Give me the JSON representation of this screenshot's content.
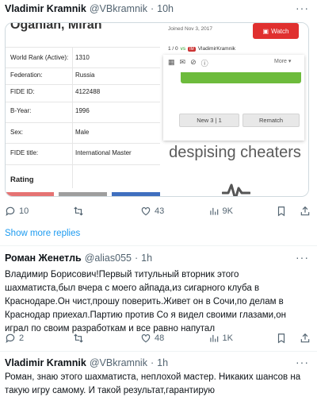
{
  "tweet1": {
    "name": "Vladimir Kramnik",
    "handle": "@VBkramnik",
    "dot": "·",
    "time": "10h",
    "media": {
      "player_name": "Oganian, Miran",
      "rows": [
        {
          "label": "World Rank (Active):",
          "value": "1310"
        },
        {
          "label": "Federation:",
          "value": "Russia"
        },
        {
          "label": "FIDE ID:",
          "value": "4122488"
        },
        {
          "label": "B-Year:",
          "value": "1996"
        },
        {
          "label": "Sex:",
          "value": "Male"
        },
        {
          "label": "FIDE title:",
          "value": "International Master"
        }
      ],
      "rating_label": "Rating",
      "joined": "Joined Nov 3, 2017",
      "watch": "Watch",
      "score_prefix": "1 / 0",
      "vs": "vs",
      "badge": "IM",
      "opponent": "VladimirKramnik",
      "more": "More",
      "new_game": "New 3 | 1",
      "rematch": "Rematch",
      "caption": "despising cheaters"
    },
    "stats": {
      "replies": "10",
      "retweets": "",
      "likes": "43",
      "views": "9K"
    }
  },
  "show_more": "Show more replies",
  "tweet2": {
    "name": "Роман Женетль",
    "handle": "@alias055",
    "dot": "·",
    "time": "1h",
    "text": "Владимир Борисович!Первый титульный вторник этого шахматиста,был вчера с моего айпада,из сигарного клуба в Краснодаре.Он чист,прошу поверить.Живет он в Сочи,по делам в Краснодар приехал.Партию против Со я видел своими глазами,он играл по своим разработкам и все равно напутал",
    "stats": {
      "replies": "2",
      "retweets": "",
      "likes": "48",
      "views": "1K"
    }
  },
  "tweet3": {
    "name": "Vladimir Kramnik",
    "handle": "@VBkramnik",
    "dot": "·",
    "time": "1h",
    "text": "Роман, знаю этого шахматиста, неплохой мастер. Никаких шансов на такую игру самому. И такой результат,гарантирую"
  },
  "colors": {
    "accent": "#1d9bf0",
    "secondary_text": "#536471",
    "watch_red": "#e0302f",
    "board_green": "#6dbb3c",
    "rating_bars": [
      "#e57373",
      "#9e9e9e",
      "#3f6fbf"
    ]
  }
}
